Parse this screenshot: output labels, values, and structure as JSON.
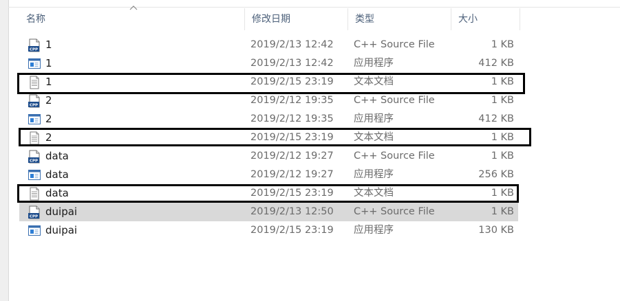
{
  "columns": {
    "name": "名称",
    "date": "修改日期",
    "type": "类型",
    "size": "大小"
  },
  "icons": {
    "cpp": "cpp-file-icon",
    "exe": "application-icon",
    "txt": "text-document-icon"
  },
  "rows": [
    {
      "name": "1",
      "date": "2019/2/13 12:42",
      "type": "C++ Source File",
      "size": "1 KB",
      "icon": "cpp"
    },
    {
      "name": "1",
      "date": "2019/2/13 12:42",
      "type": "应用程序",
      "size": "412 KB",
      "icon": "exe"
    },
    {
      "name": "1",
      "date": "2019/2/15 23:19",
      "type": "文本文档",
      "size": "1 KB",
      "icon": "txt"
    },
    {
      "name": "2",
      "date": "2019/2/12 19:35",
      "type": "C++ Source File",
      "size": "1 KB",
      "icon": "cpp"
    },
    {
      "name": "2",
      "date": "2019/2/12 19:35",
      "type": "应用程序",
      "size": "412 KB",
      "icon": "exe"
    },
    {
      "name": "2",
      "date": "2019/2/15 23:19",
      "type": "文本文档",
      "size": "1 KB",
      "icon": "txt"
    },
    {
      "name": "data",
      "date": "2019/2/12 19:27",
      "type": "C++ Source File",
      "size": "1 KB",
      "icon": "cpp"
    },
    {
      "name": "data",
      "date": "2019/2/12 19:27",
      "type": "应用程序",
      "size": "256 KB",
      "icon": "exe"
    },
    {
      "name": "data",
      "date": "2019/2/15 23:19",
      "type": "文本文档",
      "size": "1 KB",
      "icon": "txt"
    },
    {
      "name": "duipai",
      "date": "2019/2/13 12:50",
      "type": "C++ Source File",
      "size": "1 KB",
      "icon": "cpp",
      "selected": true
    },
    {
      "name": "duipai",
      "date": "2019/2/15 23:19",
      "type": "应用程序",
      "size": "130 KB",
      "icon": "exe"
    }
  ],
  "colors": {
    "header_text": "#4c607a",
    "selected_row": "#d9d9d9",
    "annotation_box": "#000000"
  }
}
